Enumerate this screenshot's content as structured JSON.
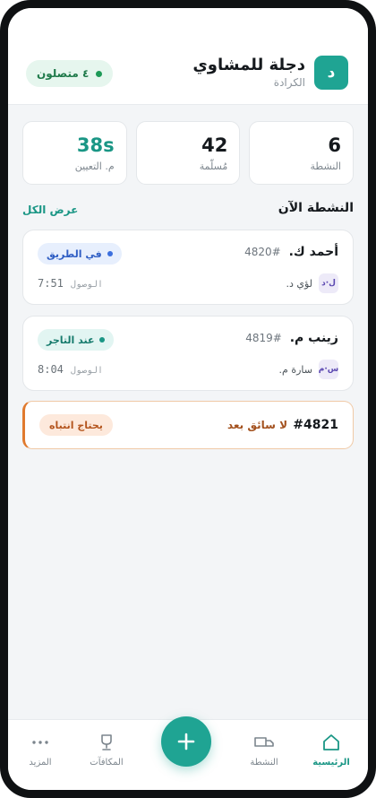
{
  "header": {
    "logo_letter": "د",
    "store_name": "دجلة للمشاوي",
    "store_area": "الكرادة",
    "online_status": "٤ متصلون"
  },
  "stats": [
    {
      "value": "6",
      "label": "النشطة",
      "accent": false
    },
    {
      "value": "42",
      "label": "مُسلّمة",
      "accent": false
    },
    {
      "value": "38s",
      "label": "م. التعيين",
      "accent": true
    }
  ],
  "active_section": {
    "title": "النشطة الآن",
    "view_all": "عرض الكل"
  },
  "orders": [
    {
      "customer": "أحمد ك.",
      "order_id": "#4820",
      "status": "في الطريق",
      "driver_initials": "ل·د",
      "driver_name": "لؤي د.",
      "eta_label": "الوصول",
      "eta_time": "7:51"
    },
    {
      "customer": "زينب م.",
      "order_id": "#4819",
      "status": "عند التاجر",
      "driver_initials": "س·م",
      "driver_name": "سارة م.",
      "eta_label": "الوصول",
      "eta_time": "8:04"
    }
  ],
  "alert": {
    "order_id": "#4821",
    "message": "لا سائق بعد",
    "badge": "يحتاج انتباه"
  },
  "nav": {
    "home": "الرئيسية",
    "active": "النشطة",
    "rewards": "المكافآت",
    "more": "المزيد"
  },
  "colors": {
    "accent": "#1fa493",
    "status_online": "#1d9a57",
    "status_en_route": "#3b6fde",
    "alert": "#e07a2e"
  }
}
